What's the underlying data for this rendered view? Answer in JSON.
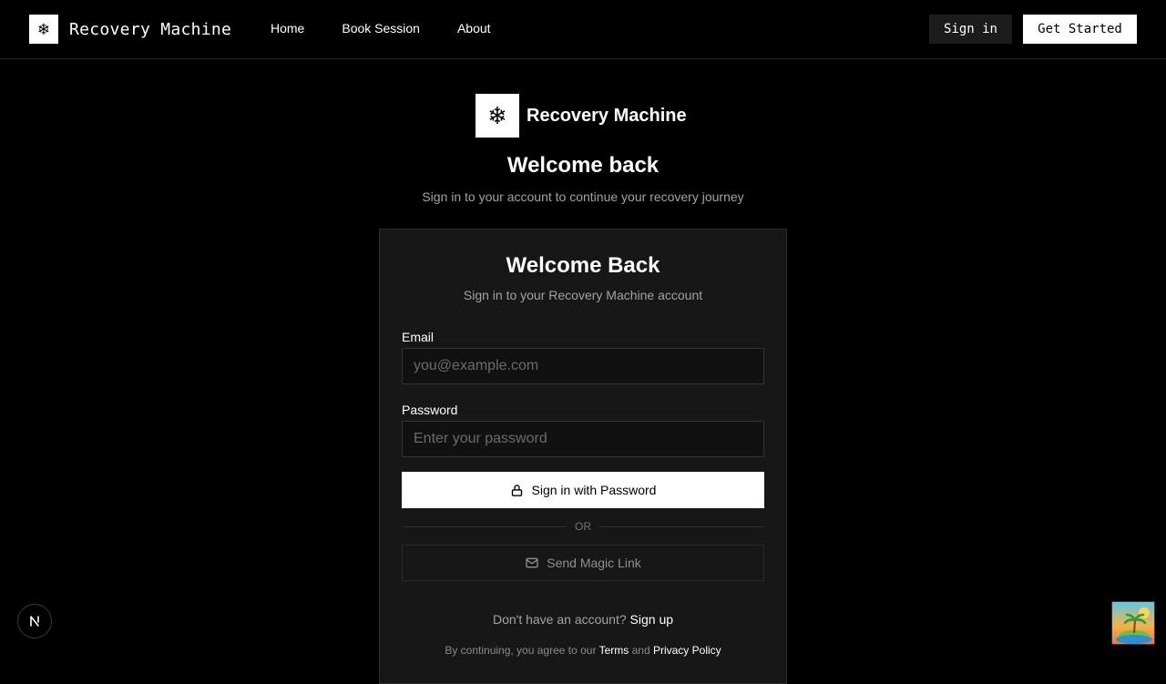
{
  "header": {
    "brand_icon": "snowflake-icon",
    "brand_name": "Recovery Machine",
    "nav": [
      {
        "label": "Home"
      },
      {
        "label": "Book Session"
      },
      {
        "label": "About"
      }
    ],
    "signin_label": "Sign in",
    "get_started_label": "Get Started"
  },
  "hero": {
    "logo_icon": "snowflake-icon",
    "brand_name": "Recovery Machine",
    "title": "Welcome back",
    "subtitle": "Sign in to your account to continue your recovery journey"
  },
  "card": {
    "title": "Welcome Back",
    "subtitle": "Sign in to your Recovery Machine account",
    "email_label": "Email",
    "email_placeholder": "you@example.com",
    "email_value": "",
    "password_label": "Password",
    "password_placeholder": "Enter your password",
    "password_value": "",
    "password_button_label": "Sign in with Password",
    "password_button_icon": "lock-icon",
    "divider_text": "OR",
    "magic_link_label": "Send Magic Link",
    "magic_link_icon": "mail-icon",
    "no_account_text": "Don't have an account?",
    "signup_link": "Sign up",
    "terms_prefix": "By continuing, you agree to our",
    "terms_link": "Terms",
    "terms_and": "and",
    "privacy_link": "Privacy Policy"
  },
  "overlays": {
    "dev_badge_icon": "nextjs-icon",
    "corner_image_icon": "island-image-icon"
  },
  "colors": {
    "background": "#000000",
    "card_background": "#171717",
    "primary_button": "#ffffff",
    "muted_text": "#a3a3a3"
  }
}
